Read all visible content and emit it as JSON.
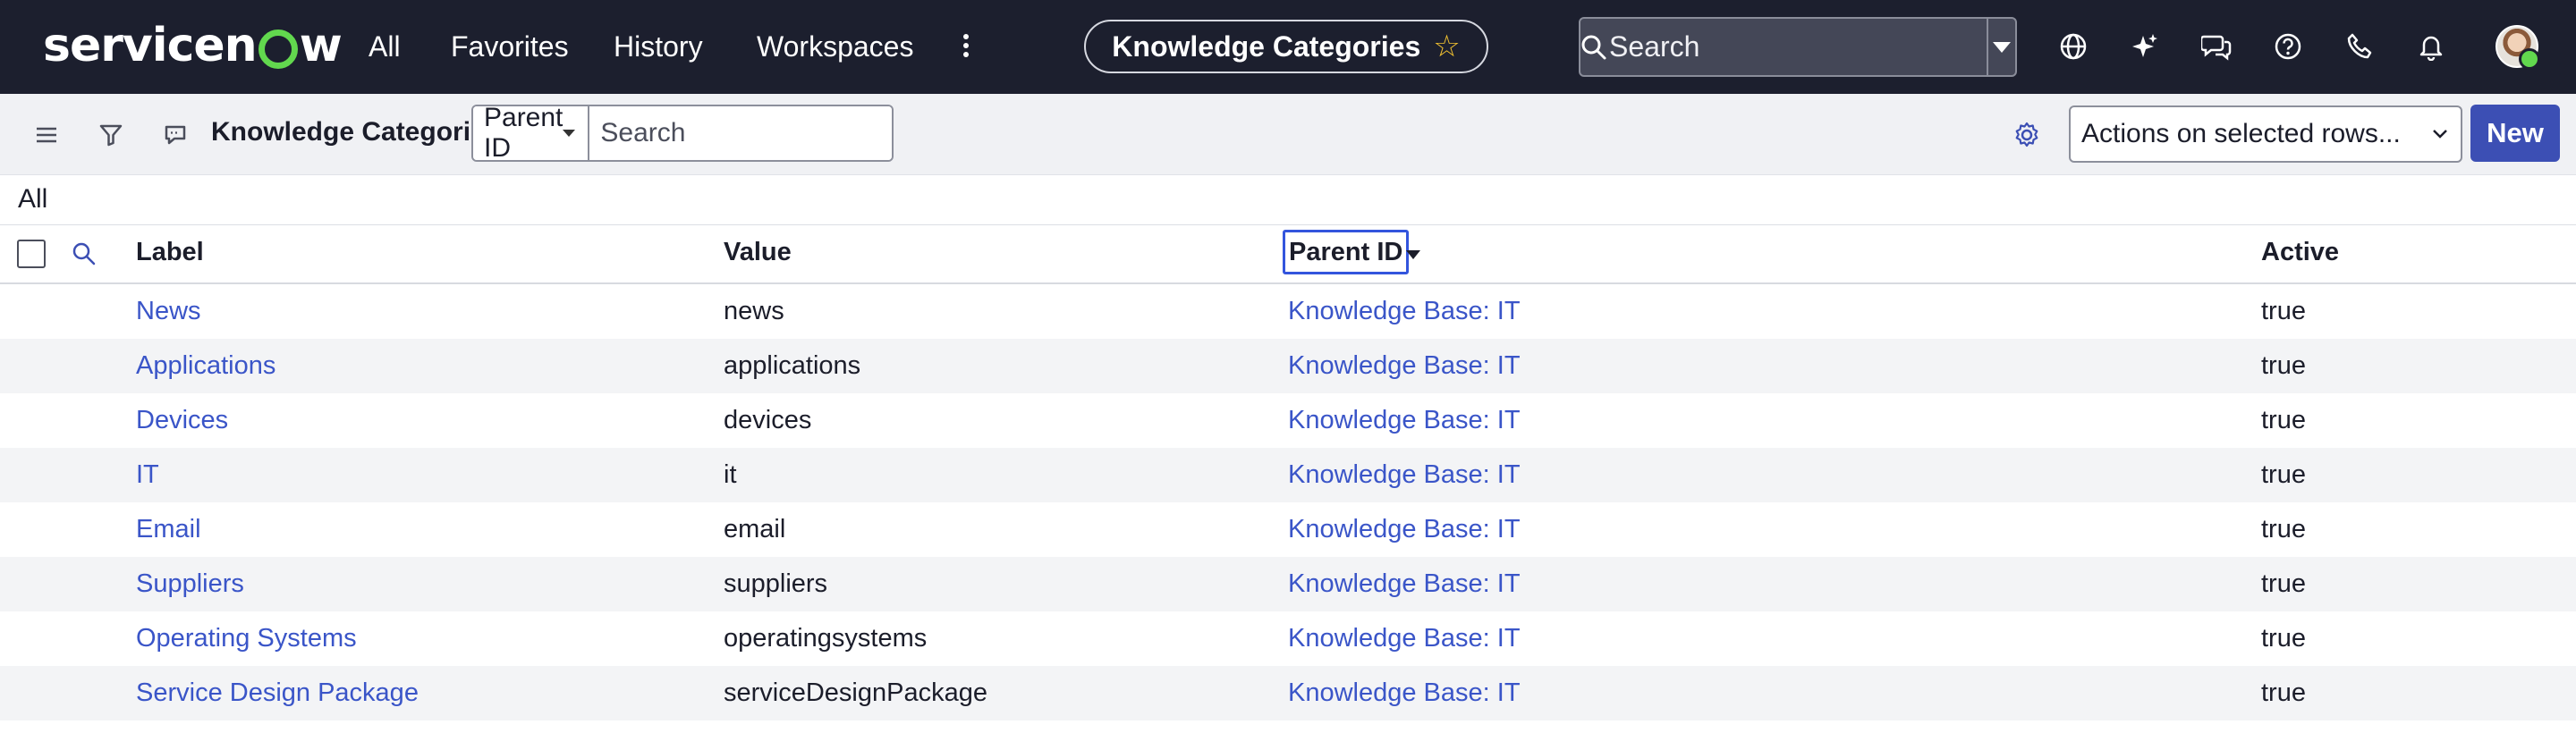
{
  "topbar": {
    "logo_text_a": "servicen",
    "logo_text_b": "w",
    "nav": [
      "All",
      "Favorites",
      "History",
      "Workspaces"
    ],
    "context_title": "Knowledge Categories",
    "search_placeholder": "Search",
    "icons": [
      "globe-icon",
      "sparkle-icon",
      "chat-icon",
      "help-icon",
      "phone-icon",
      "bell-icon"
    ],
    "brand_color": "#1c1f2e",
    "accent_color": "#62d84e"
  },
  "listbar": {
    "title": "Knowledge Categories",
    "filter_field": "Parent ID",
    "filter_placeholder": "Search",
    "actions_label": "Actions on selected rows...",
    "new_label": "New",
    "new_color": "#3c4fb4"
  },
  "breadcrumb": "All",
  "table": {
    "columns": [
      "Label",
      "Value",
      "Parent ID",
      "Active"
    ],
    "sorted_column": "Parent ID",
    "rows": [
      {
        "label": "News",
        "value": "news",
        "parent": "Knowledge Base: IT",
        "active": "true"
      },
      {
        "label": "Applications",
        "value": "applications",
        "parent": "Knowledge Base: IT",
        "active": "true"
      },
      {
        "label": "Devices",
        "value": "devices",
        "parent": "Knowledge Base: IT",
        "active": "true"
      },
      {
        "label": "IT",
        "value": "it",
        "parent": "Knowledge Base: IT",
        "active": "true"
      },
      {
        "label": "Email",
        "value": "email",
        "parent": "Knowledge Base: IT",
        "active": "true"
      },
      {
        "label": "Suppliers",
        "value": "suppliers",
        "parent": "Knowledge Base: IT",
        "active": "true"
      },
      {
        "label": "Operating Systems",
        "value": "operatingsystems",
        "parent": "Knowledge Base: IT",
        "active": "true"
      },
      {
        "label": "Service Design Package",
        "value": "serviceDesignPackage",
        "parent": "Knowledge Base: IT",
        "active": "true"
      }
    ]
  }
}
